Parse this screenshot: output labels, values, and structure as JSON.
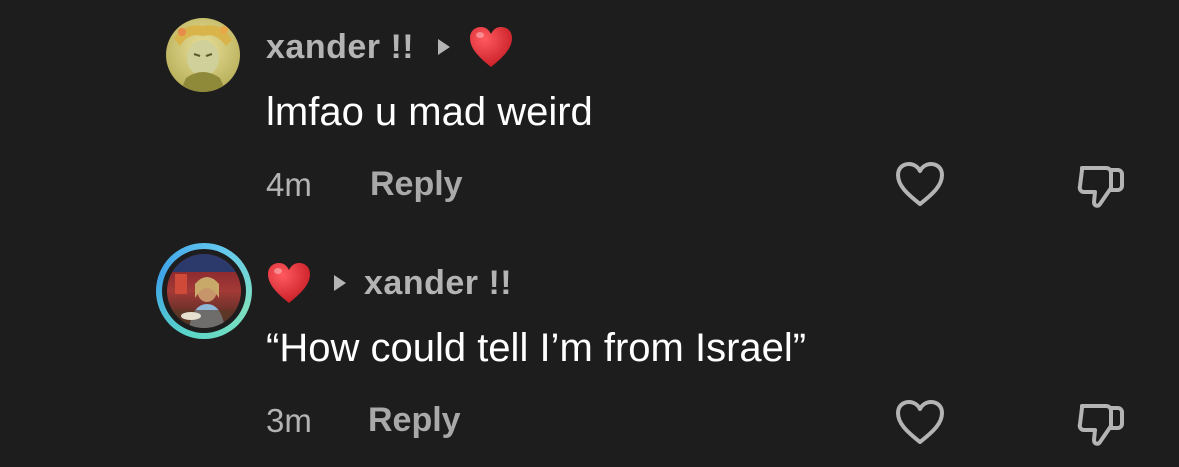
{
  "comments": [
    {
      "author": "xander !!",
      "reply_target_emoji": "heart-emoji",
      "text": "lmfao u mad weird",
      "time": "4m",
      "reply_label": "Reply",
      "avatar": "anime-avatar"
    },
    {
      "author_emoji": "heart-emoji",
      "reply_target": "xander !!",
      "text": "“How could tell I’m from Israel”",
      "time": "3m",
      "reply_label": "Reply",
      "avatar": "photo-avatar-with-story-ring"
    }
  ],
  "icons": {
    "like": "heart-outline-icon",
    "dislike": "thumbs-down-outline-icon"
  },
  "colors": {
    "background": "#1d1d1d",
    "primary_text": "#ffffff",
    "secondary_text": "#b4b4b4",
    "heart_emoji": "#e0242e",
    "story_ring": "#5ad6c8"
  }
}
